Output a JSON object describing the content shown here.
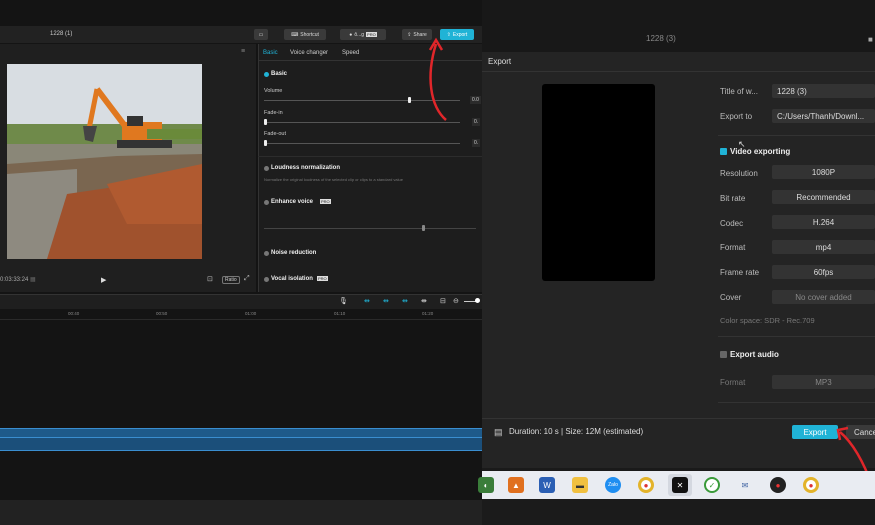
{
  "editor": {
    "title": "1228 (1)",
    "shortcut_label": "Shortcut",
    "user_label": "ô...g",
    "share_label": "Share",
    "export_label": "Export",
    "timecode": "0:03:33:24",
    "ratio_label": "Ratio",
    "tabs": [
      "Basic",
      "Voice changer",
      "Speed"
    ],
    "basic_section": "Basic",
    "volume_label": "Volume",
    "volume_value": "0.0",
    "fadein_label": "Fade-in",
    "fadein_value": "0.",
    "fadeout_label": "Fade-out",
    "fadeout_value": "0.",
    "loudness_title": "Loudness normalization",
    "loudness_desc": "Normalize the original loudness of the selected clip or clips to a standard value",
    "enhance_title": "Enhance voice",
    "noise_title": "Noise reduction",
    "vocal_title": "Vocal isolation",
    "ruler_ticks": [
      "00:40",
      "00:50",
      "01:00",
      "01:10",
      "01:20"
    ]
  },
  "dialog": {
    "window_title": "1228 (3)",
    "title": "Export",
    "fields": {
      "title_label": "Title of w...",
      "title_value": "1228 (3)",
      "export_to_label": "Export to",
      "export_to_value": "C:/Users/Thanh/Downl..."
    },
    "video_section": "Video exporting",
    "video_rows": [
      {
        "label": "Resolution",
        "value": "1080P"
      },
      {
        "label": "Bit rate",
        "value": "Recommended"
      },
      {
        "label": "Codec",
        "value": "H.264"
      },
      {
        "label": "Format",
        "value": "mp4"
      },
      {
        "label": "Frame rate",
        "value": "60fps"
      },
      {
        "label": "Cover",
        "value": "No cover added"
      }
    ],
    "color_space": "Color space: SDR - Rec.709",
    "audio_section": "Export audio",
    "audio_format_label": "Format",
    "audio_format_value": "MP3",
    "duration_text": "Duration: 10 s | Size: 12M (estimated)",
    "export_button": "Export",
    "cancel_button": "Cancel"
  },
  "colors": {
    "accent": "#20b3d6",
    "arrow": "#e0262a"
  },
  "taskbar_apps": [
    "files-app-icon",
    "word-icon",
    "folder-icon",
    "zalo-icon",
    "chrome-icon",
    "capcut-icon",
    "greenshot-icon",
    "email-icon",
    "recorder-icon",
    "chrome-icon-2"
  ]
}
